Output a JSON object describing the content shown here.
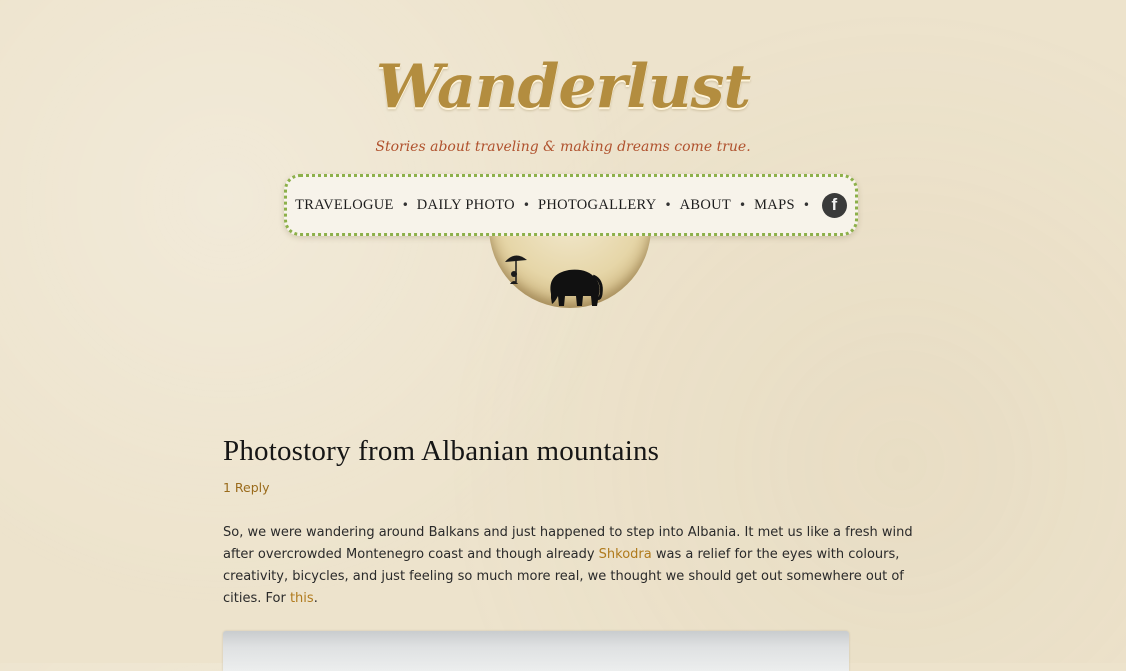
{
  "site": {
    "logo": "Wanderlust",
    "tagline": "Stories about traveling & making dreams come true."
  },
  "nav": {
    "items": [
      {
        "label": "TRAVELOGUE"
      },
      {
        "label": "DAILY PHOTO"
      },
      {
        "label": "PHOTOGALLERY"
      },
      {
        "label": "ABOUT"
      },
      {
        "label": "MAPS"
      }
    ],
    "separator": "•",
    "facebook_glyph": "f",
    "facebook_icon": "facebook-icon"
  },
  "post": {
    "title": "Photostory from Albanian mountains",
    "reply_link": "1 Reply",
    "paragraph": {
      "part1": "So, we were wandering around Balkans and just happened to step into Albania. It met us like a fresh wind after overcrowded Montenegro coast and though already ",
      "link1": "Shkodra",
      "part2": " was a relief for the eyes with colours, creativity, bicycles, and just feeling so much more real, we thought we should get out somewhere out of cities. For ",
      "link2": "this",
      "part3": "."
    }
  },
  "colors": {
    "background": "#ede3cc",
    "logo": "#b38d3f",
    "tagline": "#b0522e",
    "nav_border": "#8db04a",
    "link": "#b07a1c"
  }
}
